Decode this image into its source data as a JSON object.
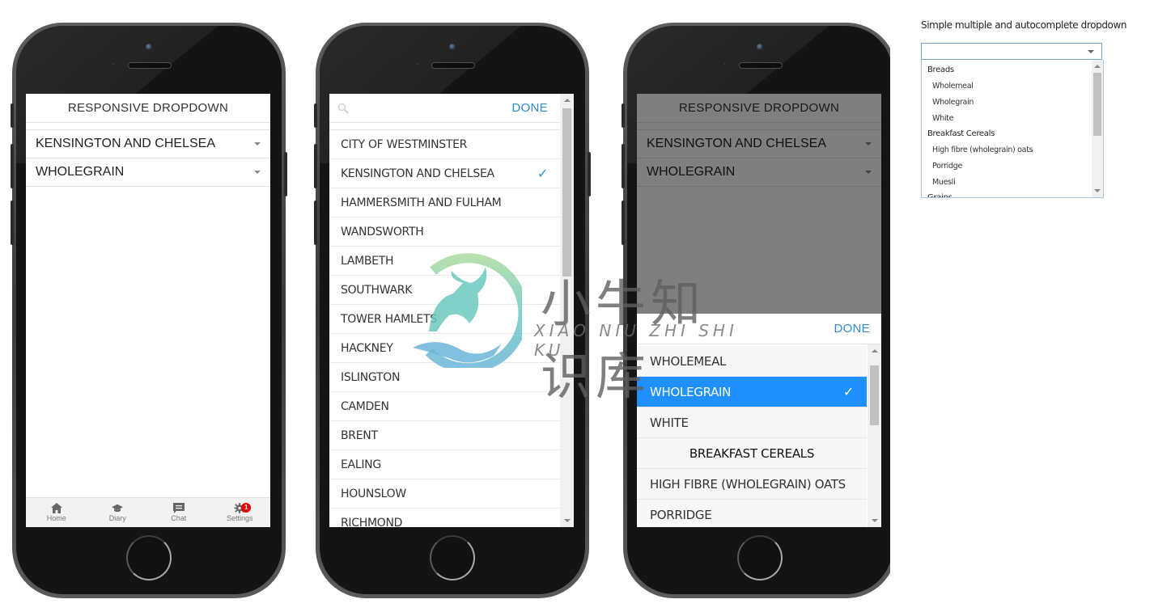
{
  "phone1": {
    "header_title": "RESPONSIVE DROPDOWN",
    "selects": [
      {
        "value": "KENSINGTON AND CHELSEA"
      },
      {
        "value": "WHOLEGRAIN"
      }
    ],
    "tabbar": [
      {
        "label": "Home",
        "icon": "home-icon"
      },
      {
        "label": "Diary",
        "icon": "graduation-cap-icon"
      },
      {
        "label": "Chat",
        "icon": "chat-icon"
      },
      {
        "label": "Settings",
        "icon": "gear-icon",
        "badge": "1"
      }
    ]
  },
  "phone2": {
    "search_icon": "search-icon",
    "done_label": "DONE",
    "selected": "KENSINGTON AND CHELSEA",
    "options": [
      "CITY OF WESTMINSTER",
      "KENSINGTON AND CHELSEA",
      "HAMMERSMITH AND FULHAM",
      "WANDSWORTH",
      "LAMBETH",
      "SOUTHWARK",
      "TOWER HAMLETS",
      "HACKNEY",
      "ISLINGTON",
      "CAMDEN",
      "BRENT",
      "EALING",
      "HOUNSLOW",
      "RICHMOND"
    ]
  },
  "phone3": {
    "header_title": "RESPONSIVE DROPDOWN",
    "selects": [
      {
        "value": "KENSINGTON AND CHELSEA"
      },
      {
        "value": "WHOLEGRAIN"
      }
    ],
    "done_label": "DONE",
    "options": [
      {
        "label": "WHOLEMEAL",
        "type": "item"
      },
      {
        "label": "WHOLEGRAIN",
        "type": "item",
        "selected": true
      },
      {
        "label": "WHITE",
        "type": "item"
      },
      {
        "label": "BREAKFAST CEREALS",
        "type": "group"
      },
      {
        "label": "HIGH FIBRE (WHOLEGRAIN) OATS",
        "type": "item"
      },
      {
        "label": "PORRIDGE",
        "type": "item"
      }
    ]
  },
  "desktop": {
    "title": "Simple multiple and autocomplete dropdown",
    "input_value": "",
    "groups": [
      {
        "label": "Breads",
        "items": [
          "Wholemeal",
          "Wholegrain",
          "White"
        ]
      },
      {
        "label": "Breakfast Cereals",
        "items": [
          "High fibre (wholegrain) oats",
          "Porridge",
          "Muesli"
        ]
      },
      {
        "label": "Grains",
        "items": []
      }
    ]
  },
  "watermark": {
    "chinese": "小牛知识库",
    "pinyin": "XIAO NIU ZHI SHI KU"
  },
  "colors": {
    "accent": "#2f8bd3",
    "selected_bg": "#1e90ff",
    "badge": "#e90000",
    "overlay": "rgba(0,0,0,0.5)"
  }
}
